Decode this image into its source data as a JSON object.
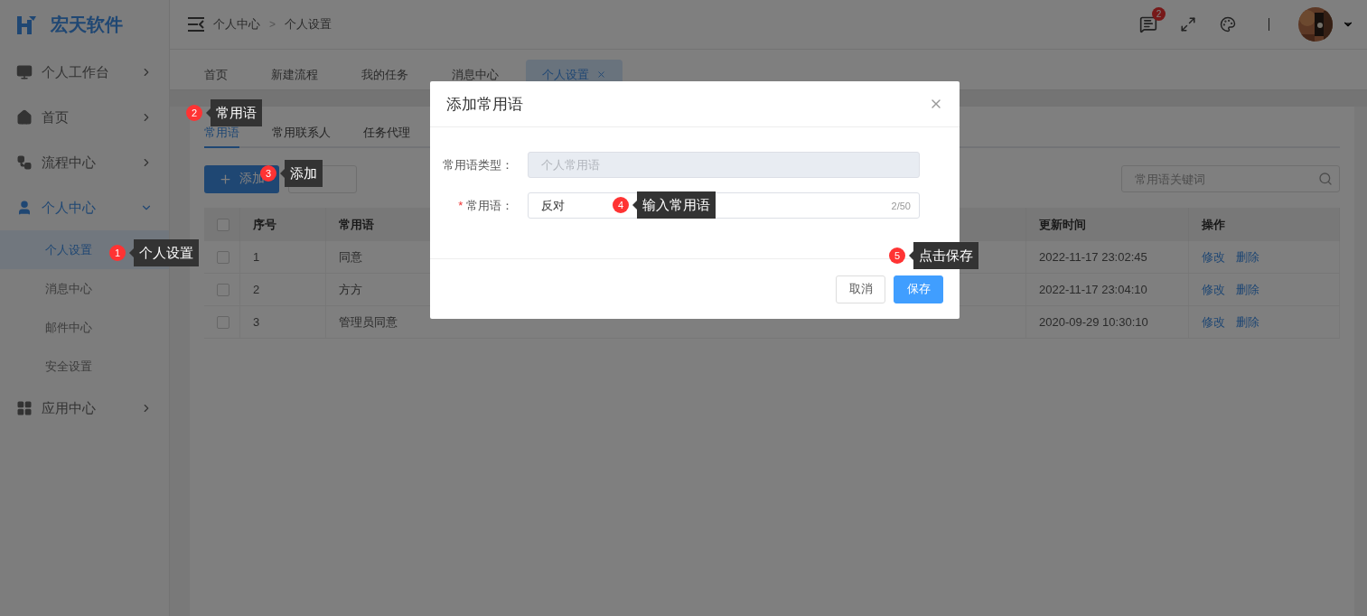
{
  "logo": {
    "text": "宏天软件"
  },
  "sidebar": {
    "items": [
      {
        "label": "个人工作台",
        "expanded": false
      },
      {
        "label": "首页",
        "expanded": false
      },
      {
        "label": "流程中心",
        "expanded": false
      },
      {
        "label": "个人中心",
        "expanded": true,
        "children": [
          {
            "label": "个人设置",
            "selected": true
          },
          {
            "label": "消息中心",
            "selected": false
          },
          {
            "label": "邮件中心",
            "selected": false
          },
          {
            "label": "安全设置",
            "selected": false
          }
        ]
      },
      {
        "label": "应用中心",
        "expanded": false
      }
    ]
  },
  "breadcrumb": [
    "个人中心",
    "个人设置"
  ],
  "breadcrumb_separator": ">",
  "header": {
    "message_badge": "2"
  },
  "page_tabs": [
    {
      "label": "首页",
      "selected": false
    },
    {
      "label": "新建流程",
      "selected": false
    },
    {
      "label": "我的任务",
      "selected": false
    },
    {
      "label": "消息中心",
      "selected": false
    },
    {
      "label": "个人设置",
      "selected": true
    }
  ],
  "inner_tabs": [
    {
      "label": "常用语",
      "selected": true
    },
    {
      "label": "常用联系人",
      "selected": false
    },
    {
      "label": "任务代理",
      "selected": false
    }
  ],
  "toolbar": {
    "add_button": "添加",
    "search_placeholder": "常用语关键词"
  },
  "table": {
    "header_checked": false,
    "columns": [
      "序号",
      "常用语",
      "更新时间",
      "操作"
    ],
    "rows": [
      {
        "checked": false,
        "index": "1",
        "phrase": "同意",
        "updated": "2022-11-17 23:02:45",
        "actions": [
          "修改",
          "删除"
        ]
      },
      {
        "checked": false,
        "index": "2",
        "phrase": "方方",
        "updated": "2022-11-17 23:04:10",
        "actions": [
          "修改",
          "删除"
        ]
      },
      {
        "checked": false,
        "index": "3",
        "phrase": "管理员同意",
        "updated": "2020-09-29 10:30:10",
        "actions": [
          "修改",
          "删除"
        ]
      }
    ]
  },
  "dialog": {
    "title": "添加常用语",
    "fields": [
      {
        "label": "常用语类型：",
        "disabled": true,
        "placeholder": "个人常用语"
      },
      {
        "label": "常用语：",
        "required_mark": "*",
        "disabled": false,
        "value": "反对",
        "counter": "2/50"
      }
    ],
    "buttons": [
      {
        "label": "取消",
        "primary": false
      },
      {
        "label": "保存",
        "primary": true
      }
    ]
  },
  "callouts": [
    {
      "number": "1",
      "text": "个人设置"
    },
    {
      "number": "2",
      "text": "常用语"
    },
    {
      "number": "3",
      "text": "添加"
    },
    {
      "number": "4",
      "text": "输入常用语"
    },
    {
      "number": "5",
      "text": "点击保存"
    }
  ]
}
